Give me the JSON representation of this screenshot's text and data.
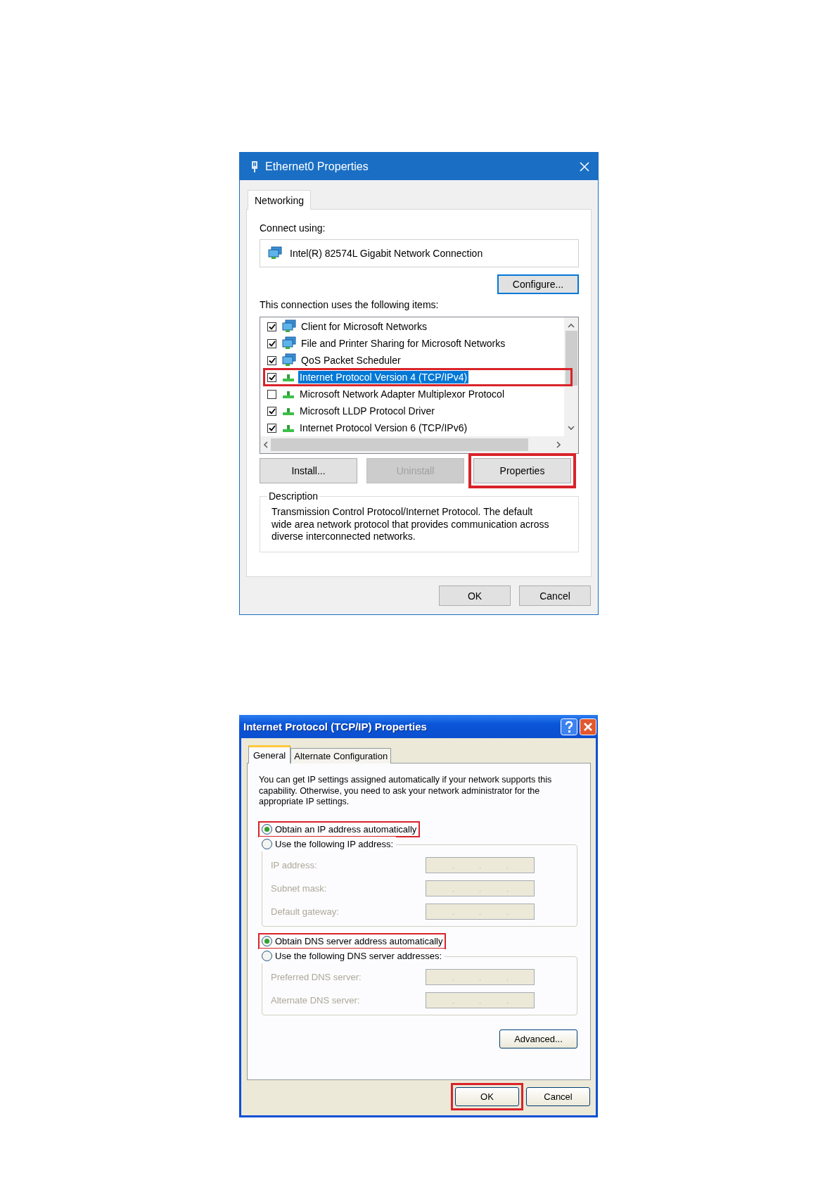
{
  "ethernet_dialog": {
    "title": "Ethernet0 Properties",
    "tabs": [
      {
        "label": "Networking",
        "selected": true
      }
    ],
    "connect_label": "Connect using:",
    "adapter": "Intel(R) 82574L Gigabit Network Connection",
    "configure_button": "Configure...",
    "items_label": "This connection uses the following items:",
    "items": [
      {
        "label": "Client for Microsoft Networks",
        "kind": "service",
        "checked": true,
        "selected": false,
        "highlighted": false
      },
      {
        "label": "File and Printer Sharing for Microsoft Networks",
        "kind": "service",
        "checked": true,
        "selected": false,
        "highlighted": false
      },
      {
        "label": "QoS Packet Scheduler",
        "kind": "service",
        "checked": true,
        "selected": false,
        "highlighted": false
      },
      {
        "label": "Internet Protocol Version 4 (TCP/IPv4)",
        "kind": "protocol",
        "checked": true,
        "selected": true,
        "highlighted": true
      },
      {
        "label": "Microsoft Network Adapter Multiplexor Protocol",
        "kind": "protocol",
        "checked": false,
        "selected": false,
        "highlighted": false
      },
      {
        "label": "Microsoft LLDP Protocol Driver",
        "kind": "protocol",
        "checked": true,
        "selected": false,
        "highlighted": false
      },
      {
        "label": "Internet Protocol Version 6 (TCP/IPv6)",
        "kind": "protocol",
        "checked": true,
        "selected": false,
        "highlighted": false
      }
    ],
    "buttons": [
      {
        "label": "Install...",
        "disabled": false,
        "highlighted": false
      },
      {
        "label": "Uninstall",
        "disabled": true,
        "highlighted": false
      },
      {
        "label": "Properties",
        "disabled": false,
        "highlighted": true
      }
    ],
    "description": {
      "title": "Description",
      "text": "Transmission Control Protocol/Internet Protocol. The default wide area network protocol that provides communication across diverse interconnected networks."
    },
    "footer_buttons": [
      {
        "label": "OK",
        "highlighted": false
      },
      {
        "label": "Cancel",
        "highlighted": false
      }
    ]
  },
  "tcpip_dialog": {
    "title": "Internet Protocol (TCP/IP) Properties",
    "tabs": [
      {
        "label": "General",
        "selected": true
      },
      {
        "label": "Alternate Configuration",
        "selected": false
      }
    ],
    "intro": "You can get IP settings assigned automatically if your network supports this capability. Otherwise, you need to ask your network administrator for the appropriate IP settings.",
    "ip_options": [
      {
        "label": "Obtain an IP address automatically",
        "selected": true,
        "highlighted": true
      },
      {
        "label": "Use the following IP address:",
        "selected": false,
        "highlighted": false
      }
    ],
    "ip_fields": [
      {
        "label": "IP address:",
        "disabled": true
      },
      {
        "label": "Subnet mask:",
        "disabled": true
      },
      {
        "label": "Default gateway:",
        "disabled": true
      }
    ],
    "dns_options": [
      {
        "label": "Obtain DNS server address automatically",
        "selected": true,
        "highlighted": true
      },
      {
        "label": "Use the following DNS server addresses:",
        "selected": false,
        "highlighted": false
      }
    ],
    "dns_fields": [
      {
        "label": "Preferred DNS server:",
        "disabled": true
      },
      {
        "label": "Alternate DNS server:",
        "disabled": true
      }
    ],
    "advanced_button": "Advanced...",
    "footer_buttons": [
      {
        "label": "OK",
        "highlighted": true
      },
      {
        "label": "Cancel",
        "highlighted": false
      }
    ]
  }
}
